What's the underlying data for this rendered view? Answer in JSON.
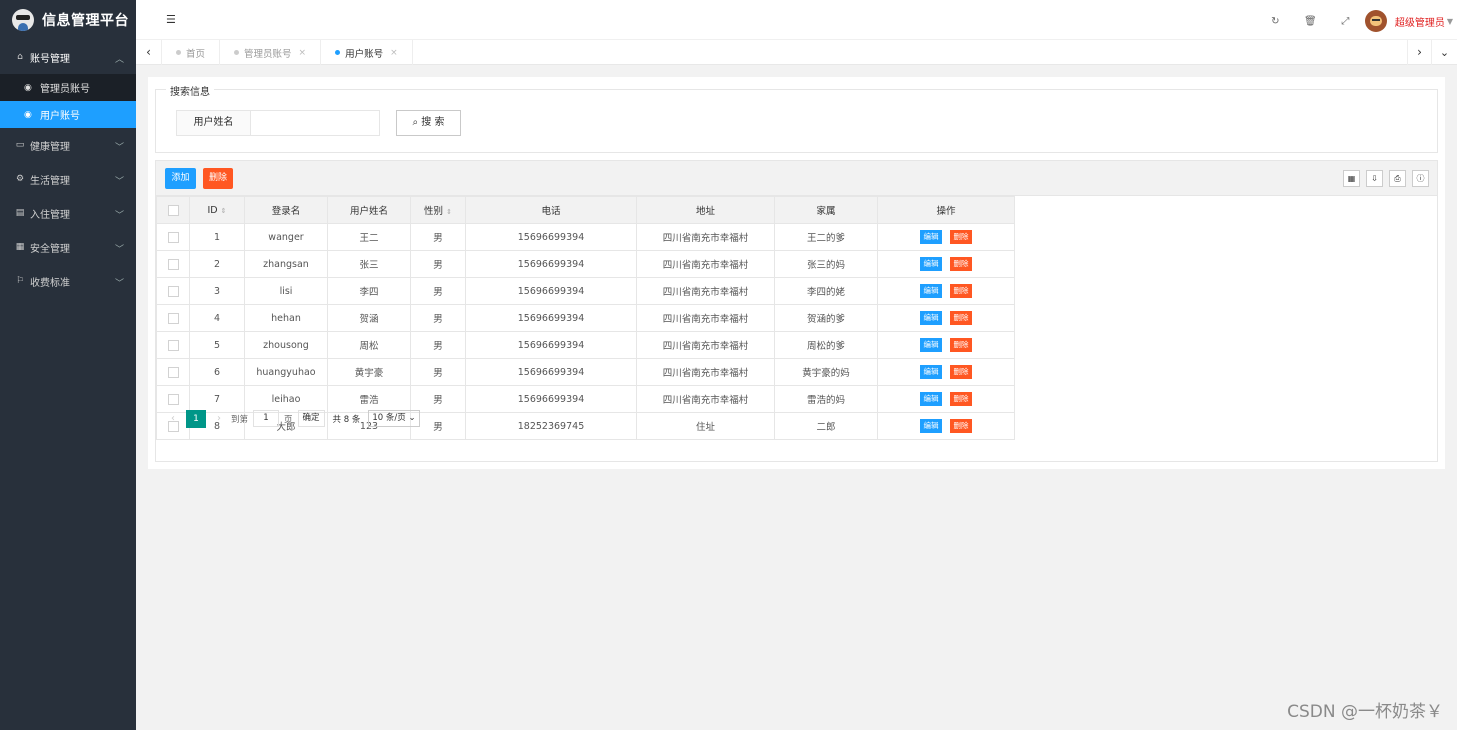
{
  "app": {
    "title": "信息管理平台"
  },
  "sidebar": {
    "groups": [
      {
        "label": "账号管理",
        "icon": "home-icon",
        "expanded": true,
        "children": [
          {
            "label": "管理员账号"
          },
          {
            "label": "用户账号",
            "active": true
          }
        ]
      },
      {
        "label": "健康管理",
        "icon": "window-icon"
      },
      {
        "label": "生活管理",
        "icon": "gears-icon"
      },
      {
        "label": "入住管理",
        "icon": "file-icon"
      },
      {
        "label": "安全管理",
        "icon": "calendar-icon"
      },
      {
        "label": "收费标准",
        "icon": "flag-icon"
      }
    ]
  },
  "header": {
    "user_name": "超级管理员",
    "icons": [
      "refresh-icon",
      "trash-icon",
      "fullscreen-icon"
    ]
  },
  "tabs": [
    {
      "label": "首页",
      "closable": false
    },
    {
      "label": "管理员账号",
      "closable": true
    },
    {
      "label": "用户账号",
      "closable": true,
      "active": true
    }
  ],
  "search": {
    "legend": "搜索信息",
    "field_label": "用户姓名",
    "field_value": "",
    "button_label": "搜 索"
  },
  "toolbar": {
    "add_label": "添加",
    "delete_label": "删除"
  },
  "table": {
    "columns": [
      "ID",
      "登录名",
      "用户姓名",
      "性别",
      "电话",
      "地址",
      "家属",
      "操作"
    ],
    "edit_label": "编辑",
    "delete_label": "删除",
    "rows": [
      {
        "id": "1",
        "login": "wanger",
        "name": "王二",
        "gender": "男",
        "phone": "15696699394",
        "address": "四川省南充市幸福村",
        "family": "王二的爹"
      },
      {
        "id": "2",
        "login": "zhangsan",
        "name": "张三",
        "gender": "男",
        "phone": "15696699394",
        "address": "四川省南充市幸福村",
        "family": "张三的妈"
      },
      {
        "id": "3",
        "login": "lisi",
        "name": "李四",
        "gender": "男",
        "phone": "15696699394",
        "address": "四川省南充市幸福村",
        "family": "李四的姥"
      },
      {
        "id": "4",
        "login": "hehan",
        "name": "贺涵",
        "gender": "男",
        "phone": "15696699394",
        "address": "四川省南充市幸福村",
        "family": "贺涵的爹"
      },
      {
        "id": "5",
        "login": "zhousong",
        "name": "周松",
        "gender": "男",
        "phone": "15696699394",
        "address": "四川省南充市幸福村",
        "family": "周松的爹"
      },
      {
        "id": "6",
        "login": "huangyuhao",
        "name": "黄宇豪",
        "gender": "男",
        "phone": "15696699394",
        "address": "四川省南充市幸福村",
        "family": "黄宇豪的妈"
      },
      {
        "id": "7",
        "login": "leihao",
        "name": "雷浩",
        "gender": "男",
        "phone": "15696699394",
        "address": "四川省南充市幸福村",
        "family": "雷浩的妈"
      },
      {
        "id": "8",
        "login": "大郎",
        "name": "123",
        "gender": "男",
        "phone": "18252369745",
        "address": "住址",
        "family": "二郎"
      }
    ]
  },
  "pager": {
    "current": "1",
    "goto_label": "到第",
    "goto_value": "1",
    "page_unit": "页",
    "confirm_label": "确定",
    "total_label": "共 8 条",
    "page_size": "10 条/页"
  },
  "watermark": "CSDN @一杯奶茶￥",
  "colors": {
    "primary": "#1e9fff",
    "danger": "#ff5722",
    "pager_active": "#009688",
    "sidebar_bg": "#28303b"
  }
}
